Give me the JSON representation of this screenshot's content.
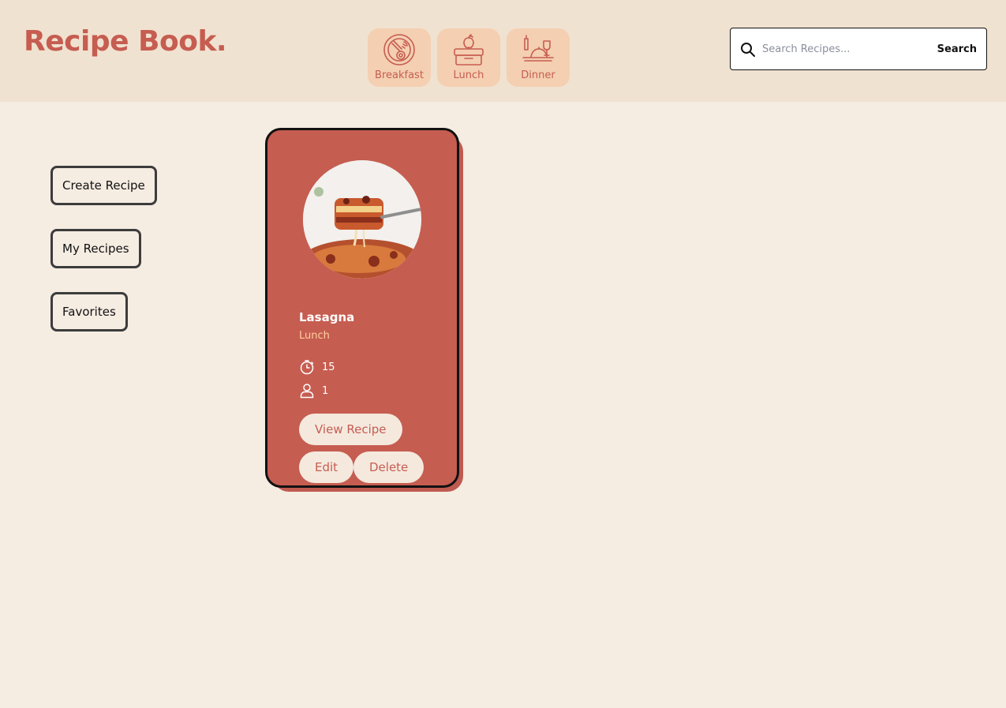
{
  "header": {
    "logo": "Recipe Book.",
    "categories": [
      {
        "label": "Breakfast",
        "icon": "breakfast-plate-icon"
      },
      {
        "label": "Lunch",
        "icon": "lunchbox-icon"
      },
      {
        "label": "Dinner",
        "icon": "dinner-table-icon"
      }
    ],
    "search": {
      "placeholder": "Search Recipes...",
      "value": "",
      "button_label": "Search"
    }
  },
  "sidebar": {
    "create_label": "Create Recipe",
    "my_recipes_label": "My Recipes",
    "favorites_label": "Favorites"
  },
  "recipes": [
    {
      "name": "Lasagna",
      "category": "Lunch",
      "time": "15",
      "servings": "1",
      "view_label": "View Recipe",
      "edit_label": "Edit",
      "delete_label": "Delete"
    }
  ],
  "colors": {
    "accent": "#c65d51",
    "header_bg": "#f0e2d0",
    "page_bg": "#f5ece2",
    "category_tile": "#f4cfb1",
    "category_text": "#ffcf9e"
  }
}
